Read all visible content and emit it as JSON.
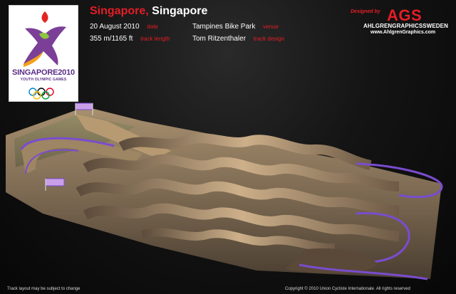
{
  "event": {
    "city": "Singapore",
    "separator": ",",
    "country": "Singapore"
  },
  "details": {
    "date_value": "20 August 2010",
    "date_label": "date",
    "venue_value": "Tampines Bike Park",
    "venue_label": "venue",
    "length_value": "355 m/1165 ft",
    "length_label": "track length",
    "designer_value": "Tom Ritzenthaler",
    "designer_label": "track design"
  },
  "olympic_logo": {
    "main_text": "SINGAPORE2010",
    "sub_text": "YOUTH OLYMPIC GAMES"
  },
  "designer_logo": {
    "designed_by": "Designed by",
    "brand": "AGS",
    "company": "AHLGRENGRAPHICSSWEDEN",
    "url": "www.AhlgrenGraphics.com"
  },
  "footer": {
    "disclaimer": "Track layout may be subject to change",
    "copyright": "Copyright © 2010 Union Cycliste Internationale. All rights reserved"
  },
  "colors": {
    "accent_red": "#e41e25",
    "track_sand": "#c9ab7c",
    "barrier_purple": "#7a4ccf",
    "background": "#0b0b0b"
  },
  "icons": [
    "olympic-rings-icon",
    "youth-olympic-figure-icon",
    "start-hill-flag-icon"
  ]
}
